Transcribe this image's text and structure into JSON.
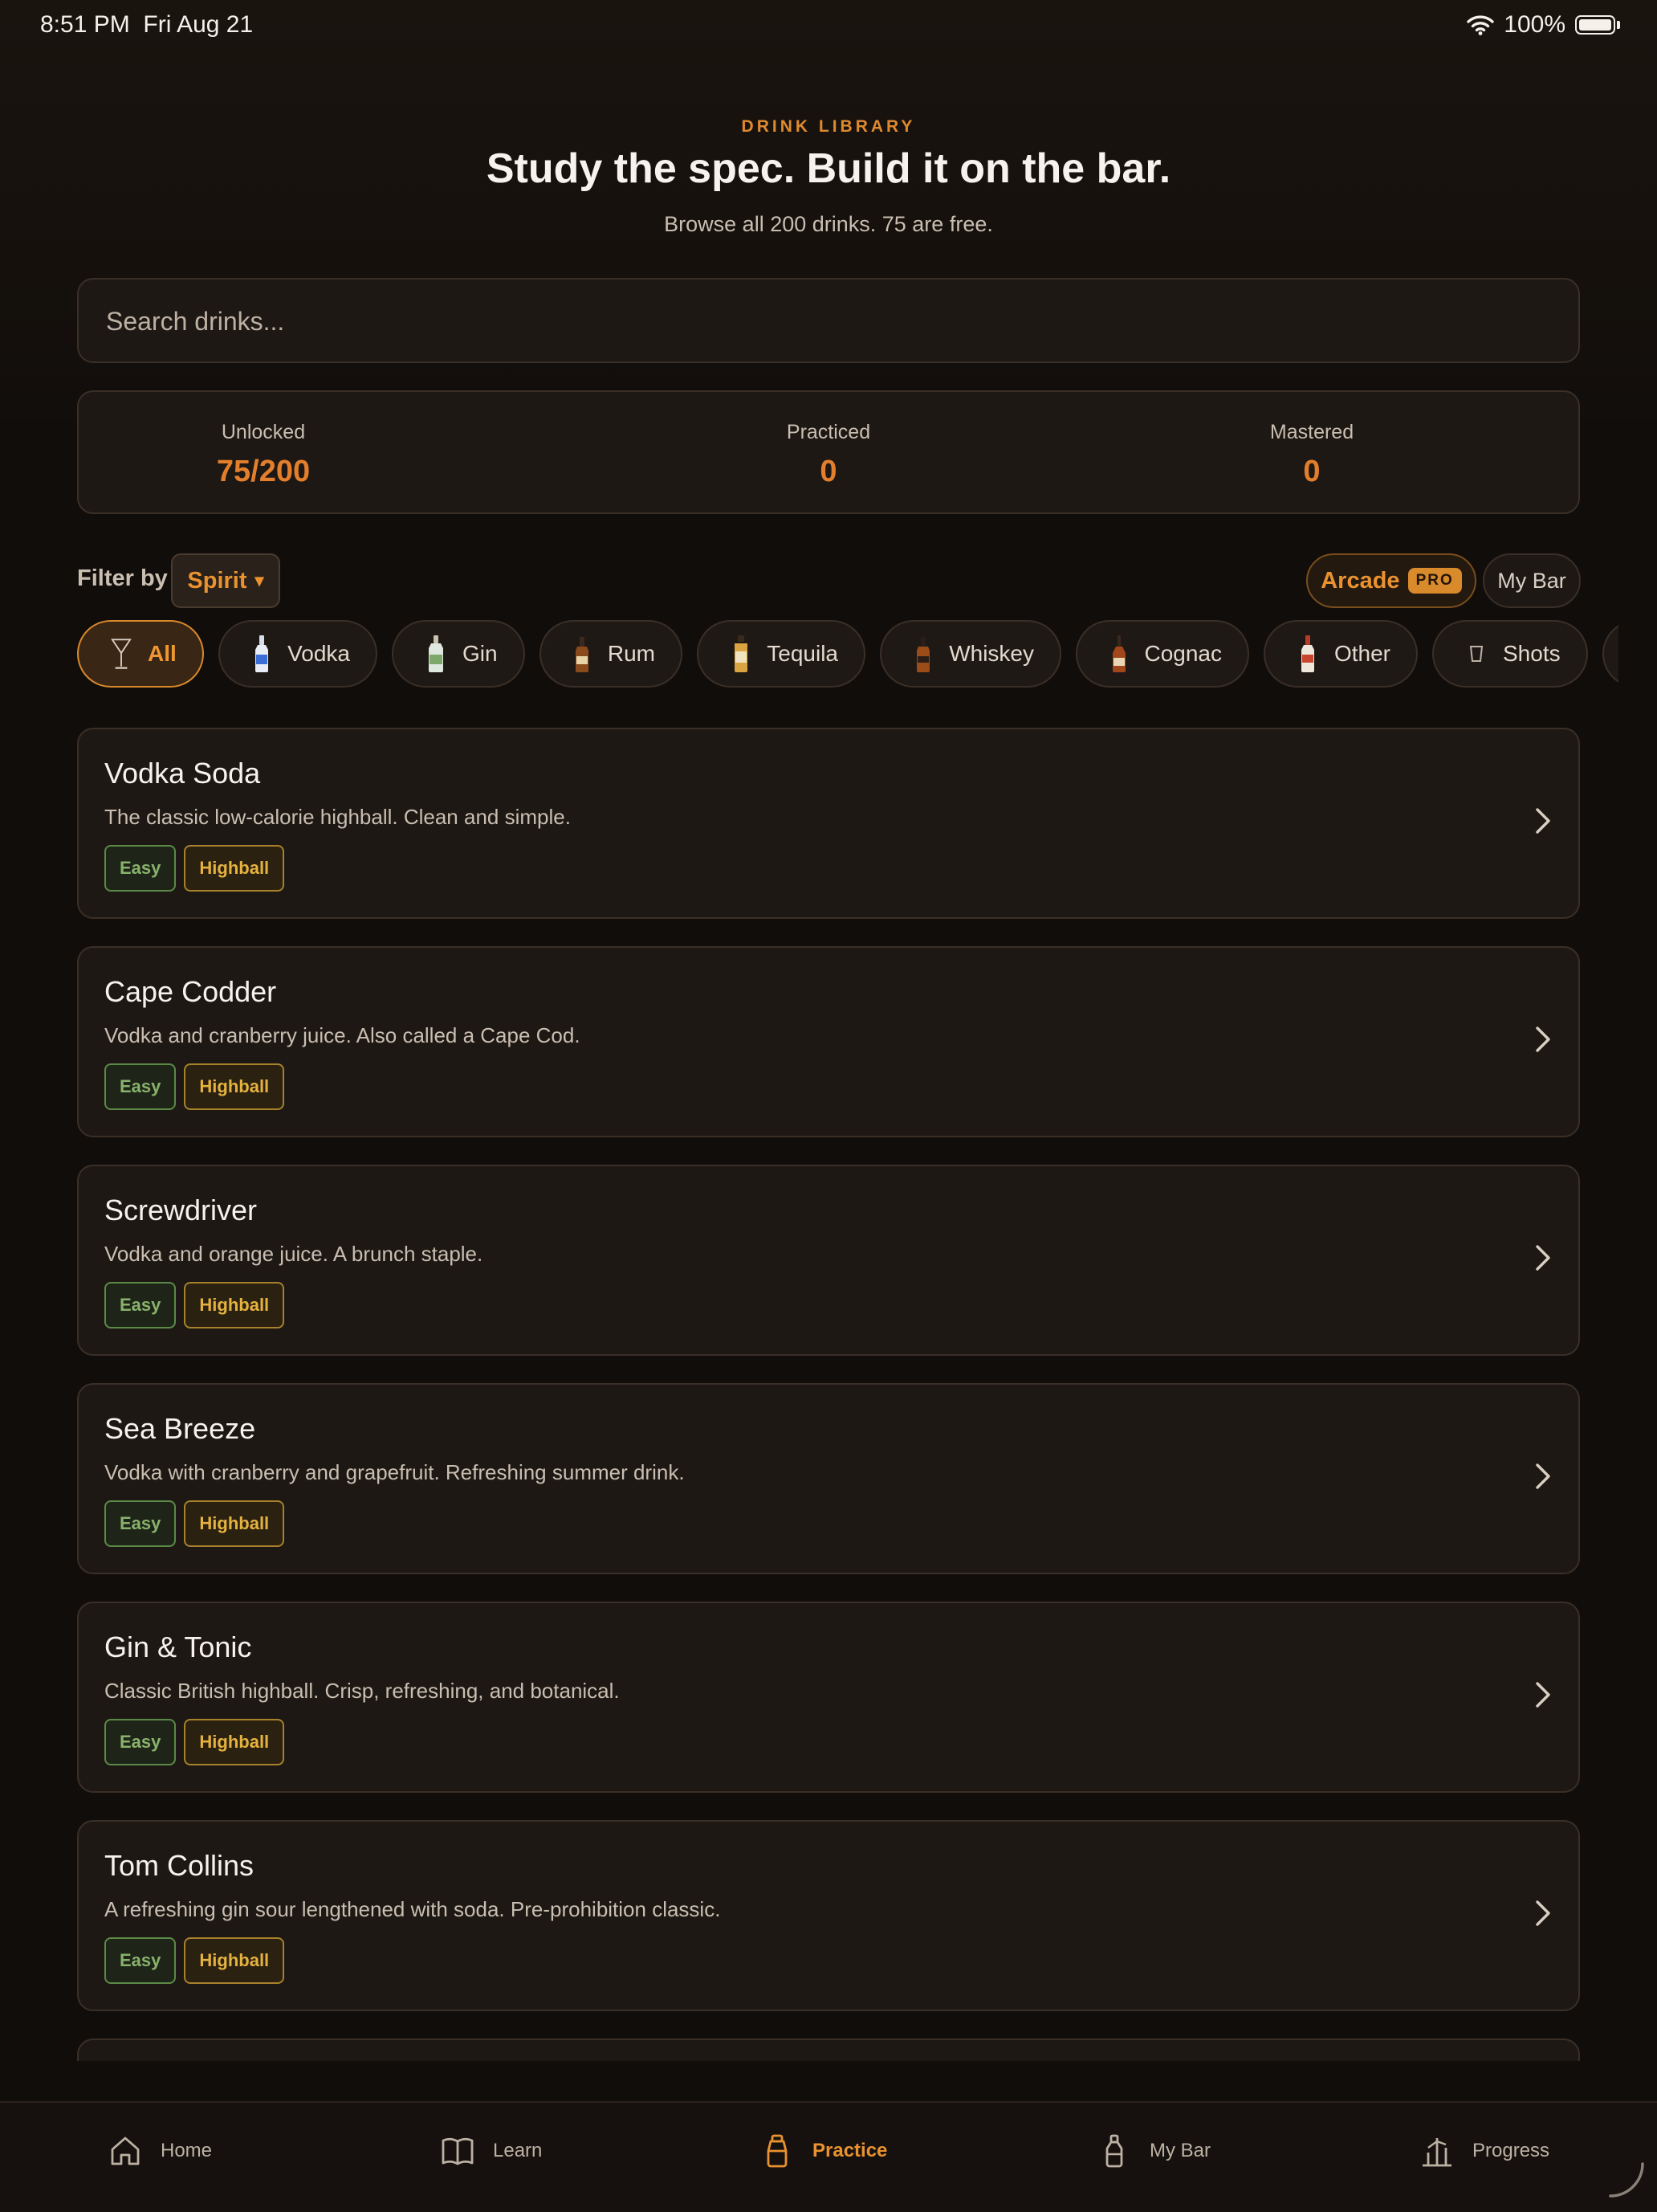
{
  "status_bar": {
    "time": "8:51 PM",
    "date": "Fri Aug 21",
    "battery": "100%"
  },
  "header": {
    "kicker": "DRINK LIBRARY",
    "title": "Study the spec. Build it on the bar.",
    "subtitle": "Browse all 200 drinks. 75 are free."
  },
  "search": {
    "placeholder": "Search drinks..."
  },
  "stats": [
    {
      "label": "Unlocked",
      "value": "75/200"
    },
    {
      "label": "Practiced",
      "value": "0"
    },
    {
      "label": "Mastered",
      "value": "0"
    }
  ],
  "filter": {
    "label": "Filter by",
    "selected": "Spirit",
    "arrow": "▾"
  },
  "arcade": {
    "label": "Arcade",
    "badge": "PRO"
  },
  "my_bar_button": {
    "label": "My Bar"
  },
  "spirit_chips": [
    {
      "label": "All",
      "icon": "martini-glass-icon",
      "active": true
    },
    {
      "label": "Vodka",
      "icon": "vodka-bottle-icon"
    },
    {
      "label": "Gin",
      "icon": "gin-bottle-icon"
    },
    {
      "label": "Rum",
      "icon": "rum-bottle-icon"
    },
    {
      "label": "Tequila",
      "icon": "tequila-bottle-icon"
    },
    {
      "label": "Whiskey",
      "icon": "whiskey-bottle-icon"
    },
    {
      "label": "Cognac",
      "icon": "cognac-bottle-icon"
    },
    {
      "label": "Other",
      "icon": "liqueur-bottle-icon"
    },
    {
      "label": "Shots",
      "icon": "shot-glass-icon"
    },
    {
      "label": "",
      "icon": ""
    }
  ],
  "drinks": [
    {
      "name": "Vodka Soda",
      "description": "The classic low-calorie highball. Clean and simple.",
      "difficulty": "Easy",
      "style": "Highball"
    },
    {
      "name": "Cape Codder",
      "description": "Vodka and cranberry juice. Also called a Cape Cod.",
      "difficulty": "Easy",
      "style": "Highball"
    },
    {
      "name": "Screwdriver",
      "description": "Vodka and orange juice. A brunch staple.",
      "difficulty": "Easy",
      "style": "Highball"
    },
    {
      "name": "Sea Breeze",
      "description": "Vodka with cranberry and grapefruit. Refreshing summer drink.",
      "difficulty": "Easy",
      "style": "Highball"
    },
    {
      "name": "Gin & Tonic",
      "description": "Classic British highball. Crisp, refreshing, and botanical.",
      "difficulty": "Easy",
      "style": "Highball"
    },
    {
      "name": "Tom Collins",
      "description": "A refreshing gin sour lengthened with soda. Pre-prohibition classic.",
      "difficulty": "Easy",
      "style": "Highball"
    },
    {
      "name": "",
      "description": "",
      "difficulty": "",
      "style": ""
    }
  ],
  "tab_bar": [
    {
      "label": "Home",
      "icon": "home-icon"
    },
    {
      "label": "Learn",
      "icon": "book-icon"
    },
    {
      "label": "Practice",
      "icon": "shaker-icon",
      "active": true
    },
    {
      "label": "My Bar",
      "icon": "bottle-icon"
    },
    {
      "label": "Progress",
      "icon": "chart-icon"
    }
  ],
  "colors": {
    "background": "#110d0a",
    "card": "#1e1814",
    "accent": "#e9922f",
    "stat_value": "#e37f2c",
    "easy": "#88b26c",
    "highball": "#e6b23f"
  }
}
